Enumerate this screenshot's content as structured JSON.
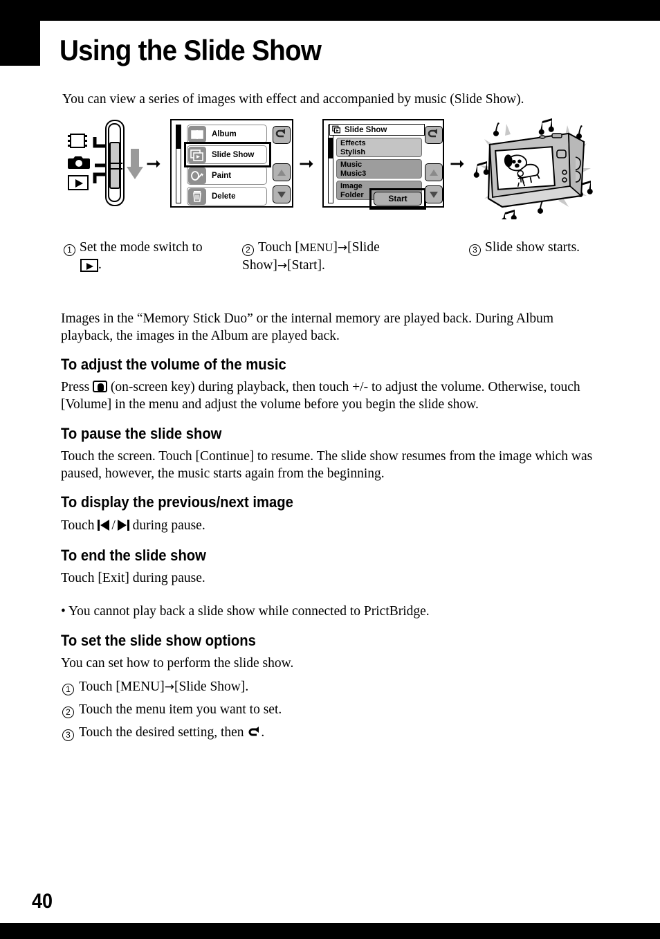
{
  "page": {
    "title": "Using the Slide Show",
    "number": "40"
  },
  "intro": "You can view a series of images with effect and accompanied by music (Slide Show).",
  "figure": {
    "mode_icons": [
      {
        "name": "movie-mode-icon",
        "label": "Movie"
      },
      {
        "name": "still-mode-icon",
        "label": "Still"
      },
      {
        "name": "playback-mode-icon",
        "label": "Playback"
      }
    ],
    "menu_panel": {
      "items": [
        {
          "label": "Album",
          "icon": "book-icon"
        },
        {
          "label": "Slide Show",
          "icon": "slideshow-icon"
        },
        {
          "label": "Paint",
          "icon": "pen-icon"
        },
        {
          "label": "Delete",
          "icon": "trash-icon"
        }
      ],
      "highlighted": "Slide Show",
      "side_buttons": [
        "return-icon",
        "scroll-up-icon",
        "scroll-down-icon"
      ]
    },
    "settings_panel": {
      "title": "Slide Show",
      "rows": [
        {
          "name": "Effects",
          "value": "Stylish"
        },
        {
          "name": "Music",
          "value": "Music3"
        },
        {
          "name": "Image",
          "value": "Folder"
        }
      ],
      "start_label": "Start",
      "side_buttons": [
        "return-icon",
        "scroll-up-icon",
        "scroll-down-icon"
      ]
    },
    "result": {
      "description": "Camera playing slide show with music notes"
    }
  },
  "steps": [
    {
      "num": "1",
      "text_before": "Set the mode switch to",
      "icon": "playback-mode-icon",
      "text_after": "."
    },
    {
      "num": "2",
      "text": "Touch [MENU]",
      "menu_label": "MENU",
      "target1": "[Slide Show]",
      "target2": "[Start]."
    },
    {
      "num": "3",
      "text": "Slide show starts."
    }
  ],
  "body": {
    "memory": "Images in the “Memory Stick Duo” or the internal memory are played back. During Album playback, the images in the Album are played back.",
    "volume": {
      "heading": "To adjust the volume of the music",
      "text_before": "Press",
      "icon": "on-screen-key-icon",
      "text_after": "(on-screen key) during playback, then touch +/- to adjust the volume. Otherwise, touch [Volume] in the menu and adjust the volume before you begin the slide show."
    },
    "pause": {
      "heading": "To pause the slide show",
      "text": "Touch the screen. Touch [Continue] to resume. The slide show resumes from the image which was paused, however, the music starts again from the beginning."
    },
    "prevnext": {
      "heading": "To display the previous/next image",
      "text_before": "Touch",
      "icon_prev": "previous-track-icon",
      "separator": "/",
      "icon_next": "next-track-icon",
      "text_after": "during pause."
    },
    "end": {
      "heading": "To end the slide show",
      "text": "Touch [Exit] during pause."
    },
    "note": "• You cannot play back a slide show while connected to PrictBridge.",
    "options": {
      "heading": "To set the slide show options",
      "intro": "You can set how to perform the slide show.",
      "steps": [
        {
          "num": "1",
          "text": "Touch [MENU]",
          "after": "[Slide Show]."
        },
        {
          "num": "2",
          "text": "Touch the menu item you want to set."
        },
        {
          "num": "3",
          "text_before": "Touch the desired setting, then",
          "icon": "return-icon",
          "text_after": "."
        }
      ]
    }
  },
  "colors": {
    "bar": "#000000",
    "panel_gray": "#9d9d9d",
    "panel_light_gray": "#c4c4c4",
    "button_gray": "#b0b0b0"
  }
}
